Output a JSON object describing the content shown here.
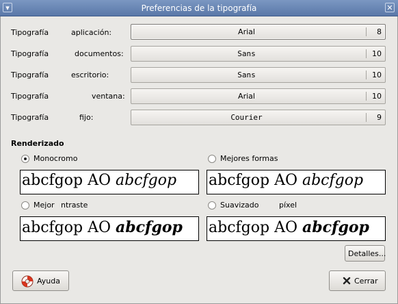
{
  "window": {
    "title": "Preferencias de la tipografía"
  },
  "fonts": [
    {
      "label": "Tipografía",
      "label2": "aplicación:",
      "name": "Arial",
      "size": "8",
      "mono": false
    },
    {
      "label": "Tipografía",
      "label2": "documentos:",
      "name": "Sans",
      "size": "10",
      "mono": true
    },
    {
      "label": "Tipografía",
      "label2": "escritorio:",
      "name": "Sans",
      "size": "10",
      "mono": true
    },
    {
      "label": "Tipografía",
      "label2": "ventana:",
      "name": "Arial",
      "size": "10",
      "mono": false
    },
    {
      "label": "Tipografía",
      "label2": "fijo:",
      "name": "Courier",
      "size": "9",
      "mono": true
    }
  ],
  "rendering": {
    "heading": "Renderizado",
    "options": [
      {
        "label": "Monocromo",
        "selected": true
      },
      {
        "label": "Mejores formas",
        "selected": false
      },
      {
        "label": "Mejor",
        "label2": "ntraste",
        "selected": false
      },
      {
        "label": "Suavizado",
        "label2": "píxel",
        "selected": false
      }
    ],
    "preview": {
      "plain": "abcfgop AO ",
      "italic": "abcfgop"
    }
  },
  "buttons": {
    "details": "Detalles...",
    "help": "Ayuda",
    "close": "Cerrar"
  },
  "icons": {
    "help": "lifebuoy-icon",
    "close": "x-icon",
    "window_menu": "window-menu-icon",
    "window_close": "window-close-icon"
  }
}
